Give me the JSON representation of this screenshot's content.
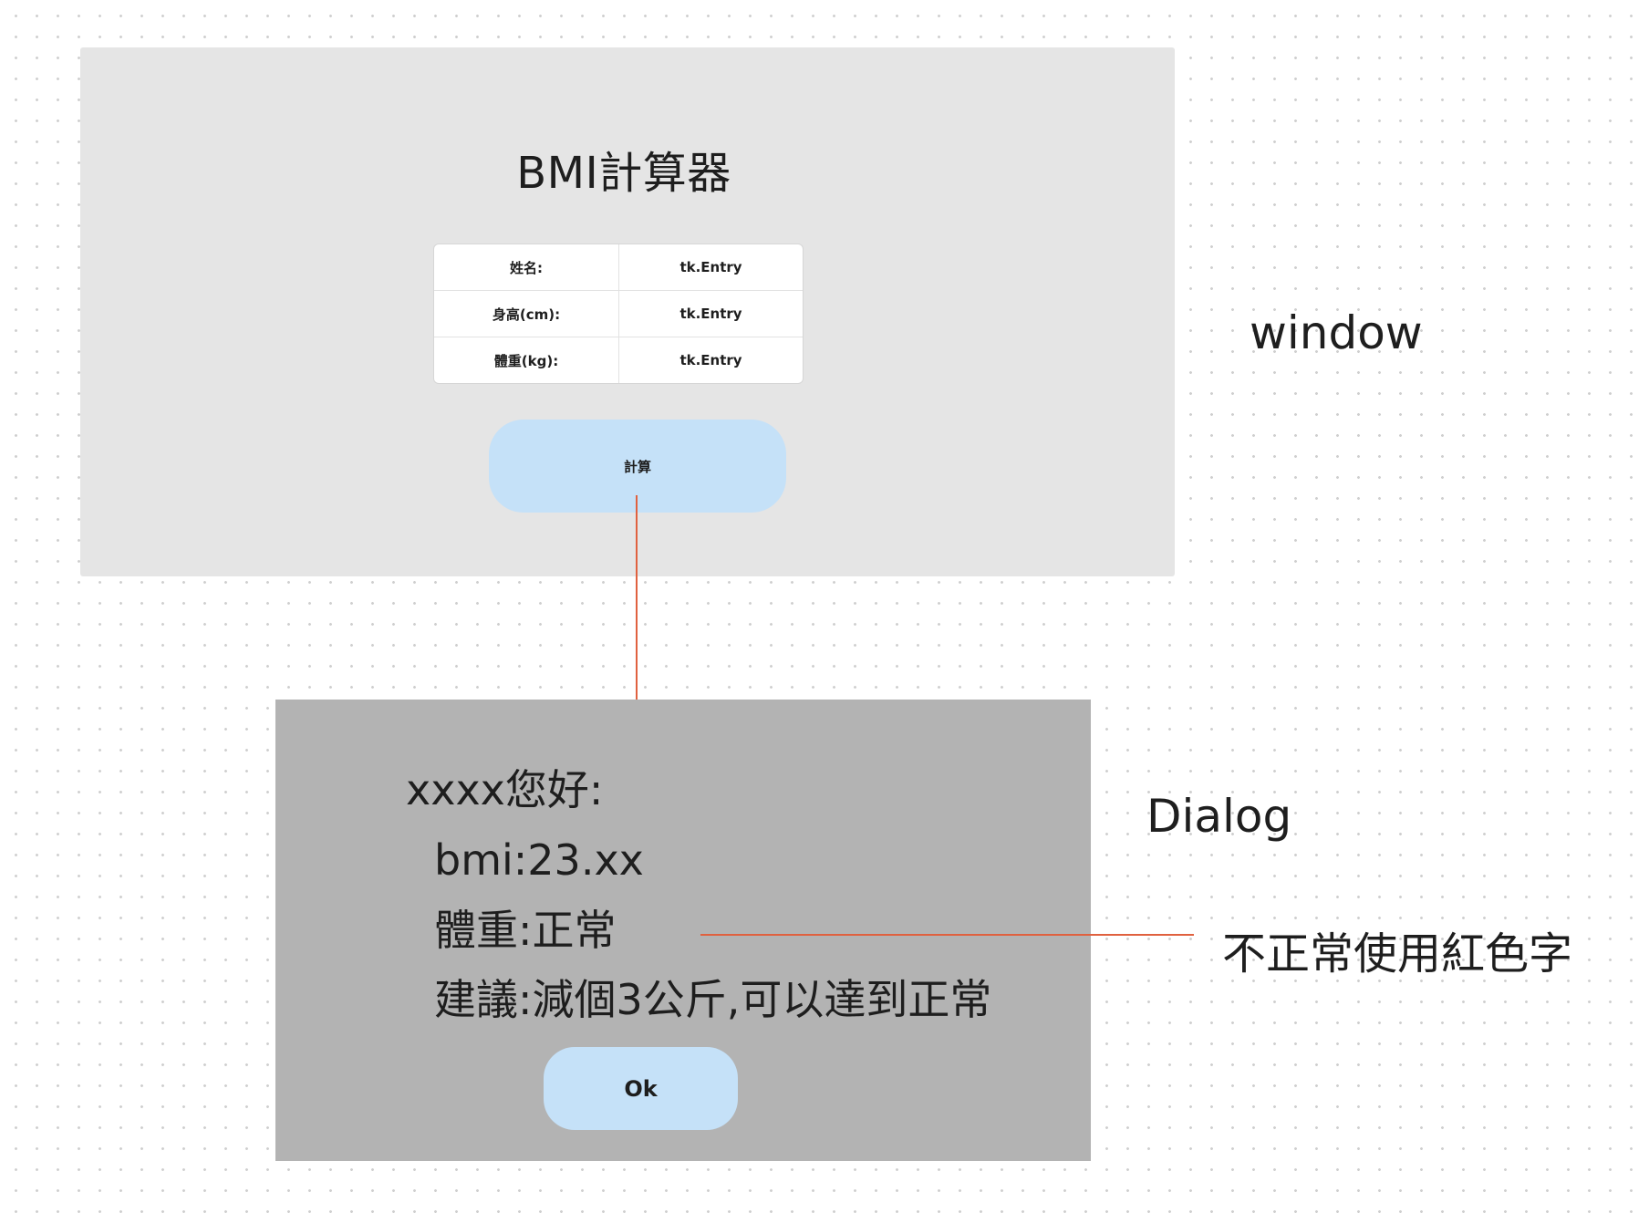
{
  "window": {
    "title": "BMI計算器",
    "form_rows": [
      {
        "label": "姓名:",
        "field": "tk.Entry"
      },
      {
        "label": "身高(cm):",
        "field": "tk.Entry"
      },
      {
        "label": "體重(kg):",
        "field": "tk.Entry"
      }
    ],
    "calculate_label": "計算",
    "annotation": "window"
  },
  "dialog": {
    "greeting": "xxxx您好:",
    "bmi_line": "bmi:23.xx",
    "status_line": "體重:正常",
    "advice_line": "建議:減個3公斤,可以達到正常",
    "ok_label": "Ok",
    "annotation": "Dialog"
  },
  "note": "不正常使用紅色字",
  "colors": {
    "window_bg": "#e5e5e5",
    "dialog_bg": "#b3b3b3",
    "button_bg": "#c5e1f8",
    "connector": "#e0613f"
  }
}
